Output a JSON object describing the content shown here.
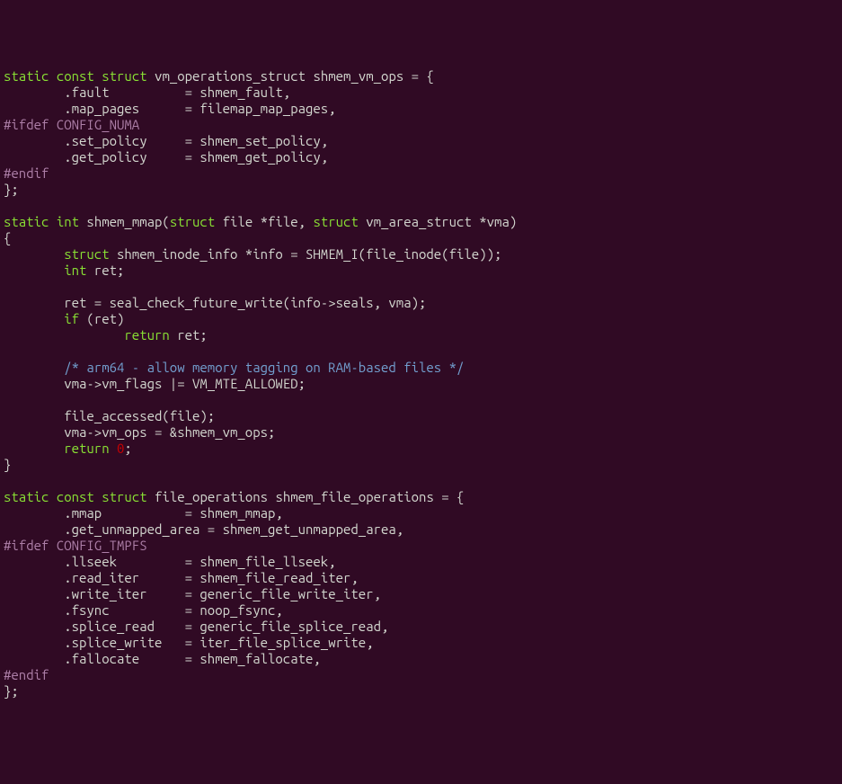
{
  "code": {
    "l1_a": "static",
    "l1_b": "const",
    "l1_c": "struct",
    "l1_d": " vm_operations_struct shmem_vm_ops = {",
    "l2": "        .fault          = shmem_fault,",
    "l3": "        .map_pages      = filemap_map_pages,",
    "l4_a": "#ifdef",
    "l4_b": " CONFIG_NUMA",
    "l5": "        .set_policy     = shmem_set_policy,",
    "l6": "        .get_policy     = shmem_get_policy,",
    "l7": "#endif",
    "l8": "};",
    "blank": " ",
    "l10_a": "static",
    "l10_b": "int",
    "l10_c": " shmem_mmap(",
    "l10_d": "struct",
    "l10_e": " file *file, ",
    "l10_f": "struct",
    "l10_g": " vm_area_struct *vma)",
    "l11": "{",
    "l12_a": "        ",
    "l12_b": "struct",
    "l12_c": " shmem_inode_info *info = SHMEM_I(file_inode(file));",
    "l13_a": "        ",
    "l13_b": "int",
    "l13_c": " ret;",
    "l15": "        ret = seal_check_future_write(info->seals, vma);",
    "l16_a": "        ",
    "l16_b": "if",
    "l16_c": " (ret)",
    "l17_a": "                ",
    "l17_b": "return",
    "l17_c": " ret;",
    "l19_a": "        ",
    "l19_b": "/* arm64 - allow memory tagging on RAM-based files */",
    "l20": "        vma->vm_flags |= VM_MTE_ALLOWED;",
    "l22": "        file_accessed(file);",
    "l23": "        vma->vm_ops = &shmem_vm_ops;",
    "l24_a": "        ",
    "l24_b": "return",
    "l24_c": " ",
    "l24_d": "0",
    "l24_e": ";",
    "l25": "}",
    "l27_a": "static",
    "l27_b": "const",
    "l27_c": "struct",
    "l27_d": " file_operations shmem_file_operations = {",
    "l28": "        .mmap           = shmem_mmap,",
    "l29": "        .get_unmapped_area = shmem_get_unmapped_area,",
    "l30_a": "#ifdef",
    "l30_b": " CONFIG_TMPFS",
    "l31": "        .llseek         = shmem_file_llseek,",
    "l32": "        .read_iter      = shmem_file_read_iter,",
    "l33": "        .write_iter     = generic_file_write_iter,",
    "l34": "        .fsync          = noop_fsync,",
    "l35": "        .splice_read    = generic_file_splice_read,",
    "l36": "        .splice_write   = iter_file_splice_write,",
    "l37": "        .fallocate      = shmem_fallocate,",
    "l38": "#endif",
    "l39": "};"
  }
}
